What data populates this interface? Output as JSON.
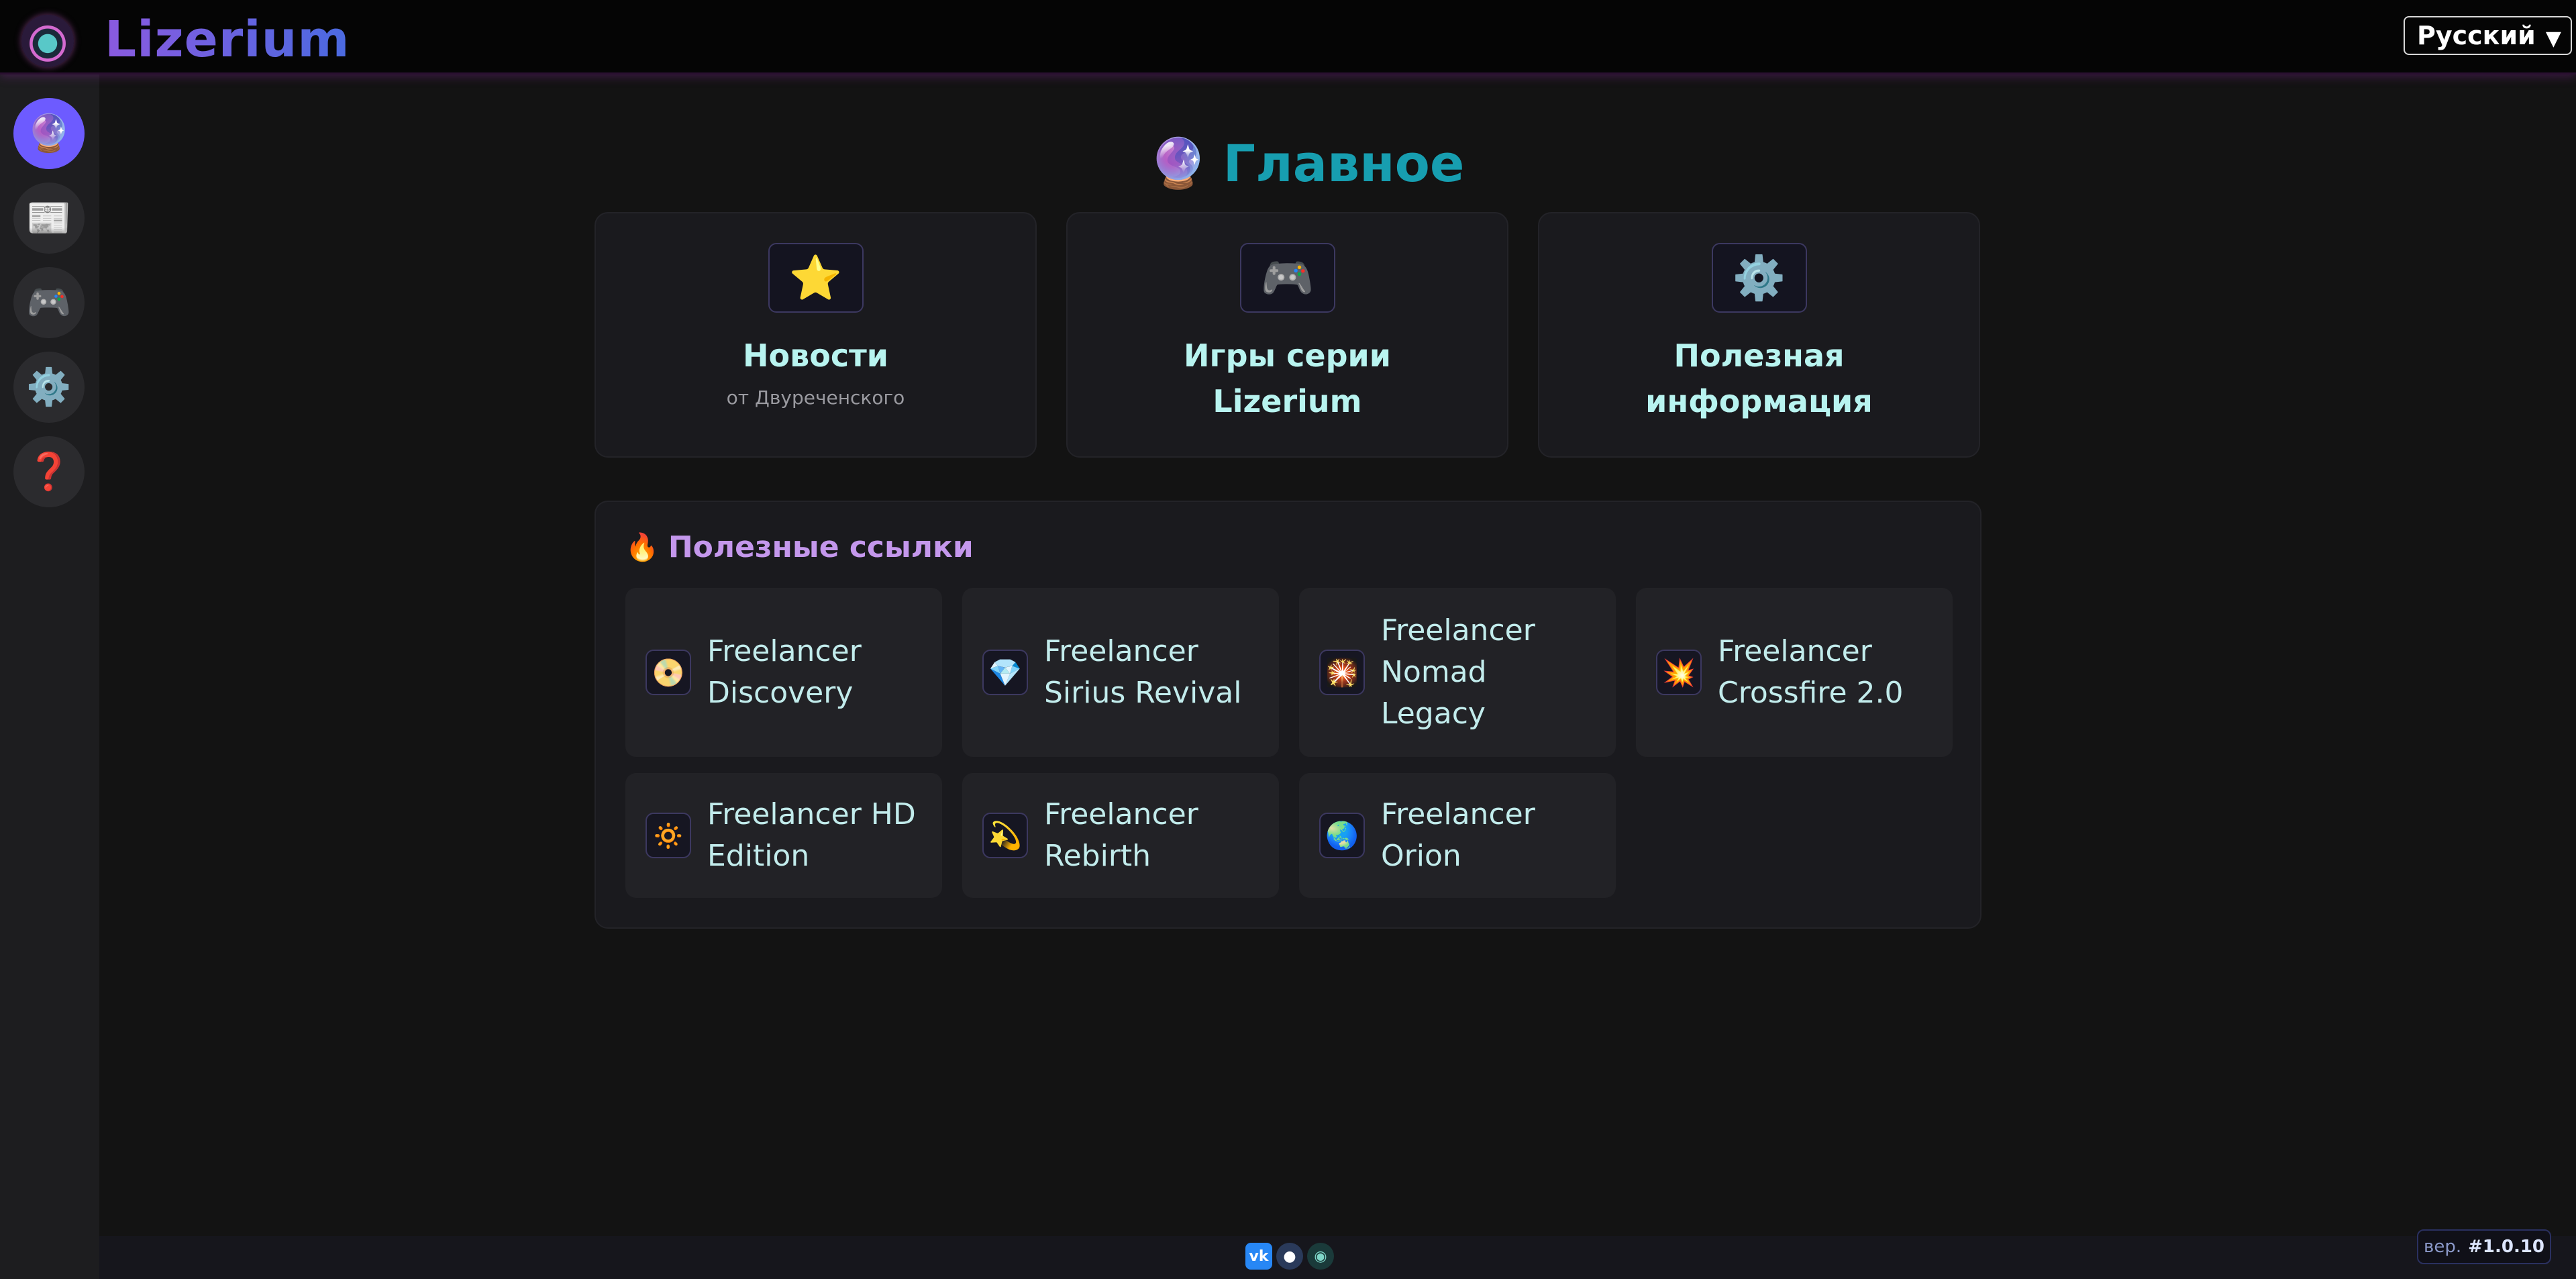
{
  "header": {
    "logo_icon": "lizerium-logo-icon",
    "app_title": "Lizerium",
    "language_selected": "Русский"
  },
  "sidebar": {
    "items": [
      {
        "name": "crystal-ball-icon",
        "glyph": "🔮",
        "active": true
      },
      {
        "name": "newspaper-icon",
        "glyph": "📰",
        "active": false
      },
      {
        "name": "gamepad-icon",
        "glyph": "🎮",
        "active": false
      },
      {
        "name": "gear-icon",
        "glyph": "⚙️",
        "active": false
      },
      {
        "name": "question-icon",
        "glyph": "❓",
        "active": false
      }
    ]
  },
  "main": {
    "title_icon": "🔮",
    "title": "Главное",
    "cards": [
      {
        "icon": "⭐",
        "title": "Новости",
        "subtitle": "от Двуреченского"
      },
      {
        "icon": "🎮",
        "title_line1": "Игры серии",
        "title_line2": "Lizerium"
      },
      {
        "icon": "⚙️",
        "title_line1": "Полезная",
        "title_line2": "информация"
      }
    ]
  },
  "links": {
    "heading_icon": "🔥",
    "heading": "Полезные ссылки",
    "items": [
      {
        "icon": "📀",
        "line1": "Freelancer",
        "line2": "Discovery"
      },
      {
        "icon": "💎",
        "line1": "Freelancer",
        "line2": "Sirius Revival"
      },
      {
        "icon": "🎇",
        "line1": "Freelancer",
        "line2": "Nomad",
        "line3": "Legacy"
      },
      {
        "icon": "💥",
        "line1": "Freelancer",
        "line2": "Crossfire 2.0"
      },
      {
        "icon": "🔅",
        "line1": "Freelancer HD",
        "line2": "Edition"
      },
      {
        "icon": "💫",
        "line1": "Freelancer",
        "line2": "Rebirth"
      },
      {
        "icon": "🌏",
        "line1": "Freelancer",
        "line2": "Orion"
      }
    ]
  },
  "footer": {
    "socials": [
      "vk-icon",
      "github-icon",
      "site-icon"
    ],
    "version_label": "вер.",
    "version_number": "#1.0.10"
  },
  "colors": {
    "accent": "#6d5bff",
    "title": "#179eb0",
    "card_title": "#b8f4f0",
    "links_heading": "#c497ec"
  }
}
